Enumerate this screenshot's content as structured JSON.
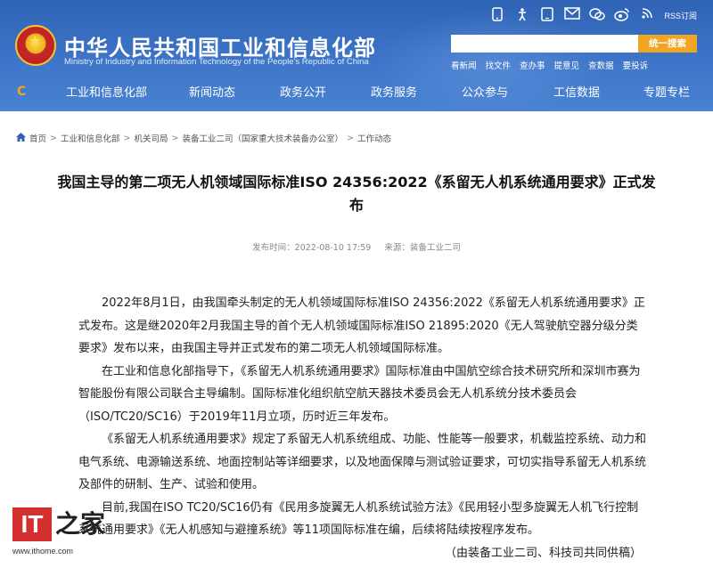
{
  "header": {
    "site_title": "中华人民共和国工业和信息化部",
    "site_subtitle": "Ministry of Industry and Information Technology of the People's Republic of China",
    "top_icons": [
      "mobile-icon",
      "accessibility-icon",
      "tablet-icon",
      "mail-icon",
      "wechat-icon",
      "weibo-icon",
      "rss-icon"
    ],
    "rss_label": "RSS订阅",
    "search_placeholder": "",
    "search_button": "统一搜索",
    "quick_links": [
      "看新闻",
      "找文件",
      "查办事",
      "提意见",
      "查数据",
      "要投诉"
    ]
  },
  "nav": {
    "items": [
      "工业和信息化部",
      "新闻动态",
      "政务公开",
      "政务服务",
      "公众参与",
      "工信数据",
      "专题专栏"
    ]
  },
  "breadcrumb": {
    "items": [
      "首页",
      "工业和信息化部",
      "机关司局",
      "装备工业二司（国家重大技术装备办公室）",
      "工作动态"
    ]
  },
  "article": {
    "title": "我国主导的第二项无人机领域国际标准ISO 24356:2022《系留无人机系统通用要求》正式发布",
    "publish_label": "发布时间：2022-08-10 17:59",
    "source_label": "来源：装备工业二司",
    "paragraphs": [
      "2022年8月1日，由我国牵头制定的无人机领域国际标准ISO 24356:2022《系留无人机系统通用要求》正式发布。这是继2020年2月我国主导的首个无人机领域国际标准ISO 21895:2020《无人驾驶航空器分级分类要求》发布以来，由我国主导并正式发布的第二项无人机领域国际标准。",
      "在工业和信息化部指导下，《系留无人机系统通用要求》国际标准由中国航空综合技术研究所和深圳市赛为智能股份有限公司联合主导编制。国际标准化组织航空航天器技术委员会无人机系统分技术委员会（ISO/TC20/SC16）于2019年11月立项，历时近三年发布。",
      "《系留无人机系统通用要求》规定了系留无人机系统组成、功能、性能等一般要求，机载监控系统、动力和电气系统、电源输送系统、地面控制站等详细要求，以及地面保障与测试验证要求，可切实指导系留无人机系统及部件的研制、生产、试验和使用。",
      "目前,我国在ISO TC20/SC16仍有《民用多旋翼无人机系统试验方法》《民用轻小型多旋翼无人机飞行控制系统通用要求》《无人机感知与避撞系统》等11项国际标准在编，后续将陆续按程序发布。"
    ],
    "source_note": "（由装备工业二司、科技司共同供稿）"
  },
  "watermark": {
    "logo_it": "IT",
    "logo_zhi": "之家",
    "url": "www.ithome.com"
  }
}
